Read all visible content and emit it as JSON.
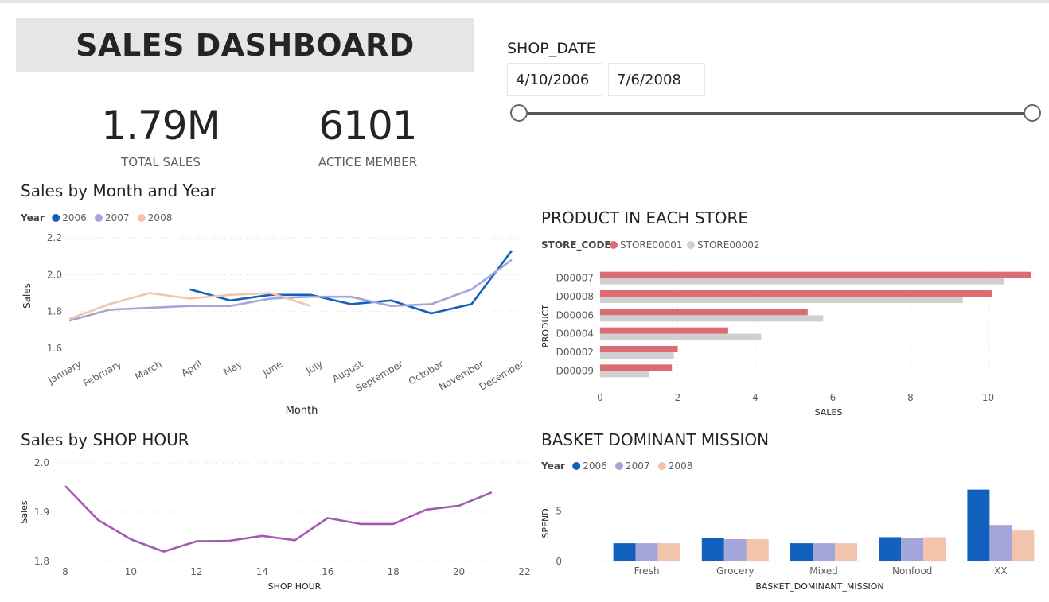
{
  "dashboard": {
    "title": "SALES DASHBOARD"
  },
  "kpis": [
    {
      "value": "1.79M",
      "label": "TOTAL SALES"
    },
    {
      "value": "6101",
      "label": "ACTICE MEMBER"
    }
  ],
  "slicer": {
    "title": "SHOP_DATE",
    "start": "4/10/2006",
    "end": "7/6/2008",
    "range_selected": [
      0.0,
      1.0
    ]
  },
  "colors": {
    "y2006": "#1261bf",
    "y2007": "#a4a5d8",
    "y2008": "#f2c4ac",
    "store1": "#dd6b73",
    "store2": "#cfcfcf",
    "hour_line": "#a35bb0"
  },
  "chart_data": [
    {
      "id": "month",
      "type": "line",
      "title": "Sales by Month and Year",
      "legend_title": "Year",
      "xlabel": "Month",
      "ylabel": "Sales",
      "categories": [
        "January",
        "February",
        "March",
        "April",
        "May",
        "June",
        "July",
        "August",
        "September",
        "October",
        "November",
        "December"
      ],
      "yticks": [
        "1.6",
        "1.8",
        "2.0",
        "2.2"
      ],
      "ylim": [
        1.57,
        2.2
      ],
      "series": [
        {
          "name": "2006",
          "color": "#1261bf",
          "values": [
            null,
            null,
            null,
            1.92,
            1.86,
            1.89,
            1.89,
            1.84,
            1.86,
            1.79,
            1.84,
            2.13
          ]
        },
        {
          "name": "2007",
          "color": "#a4a5d8",
          "values": [
            1.75,
            1.81,
            1.82,
            1.83,
            1.83,
            1.87,
            1.88,
            1.88,
            1.83,
            1.84,
            1.92,
            2.08
          ]
        },
        {
          "name": "2008",
          "color": "#f2c4ac",
          "values": [
            1.76,
            1.84,
            1.9,
            1.87,
            1.89,
            1.9,
            1.83,
            null,
            null,
            null,
            null,
            null
          ]
        }
      ]
    },
    {
      "id": "store",
      "type": "bar",
      "orientation": "horizontal",
      "title": "PRODUCT IN EACH STORE",
      "legend_title": "STORE_CODE",
      "xlabel": "SALES",
      "ylabel": "PRODUCT",
      "categories": [
        "D00007",
        "D00008",
        "D00006",
        "D00004",
        "D00002",
        "D00009"
      ],
      "xticks": [
        "0",
        "2",
        "4",
        "6",
        "8",
        "10"
      ],
      "xlim": [
        0,
        11.2
      ],
      "series": [
        {
          "name": "STORE00001",
          "color": "#dd6b73",
          "values": [
            11.1,
            10.1,
            5.35,
            3.3,
            2.0,
            1.85
          ]
        },
        {
          "name": "STORE00002",
          "color": "#cfcfcf",
          "values": [
            10.4,
            9.35,
            5.75,
            4.15,
            1.9,
            1.25
          ]
        }
      ]
    },
    {
      "id": "hour",
      "type": "line",
      "title": "Sales by SHOP HOUR",
      "xlabel": "SHOP HOUR",
      "ylabel": "Sales",
      "xticks": [
        "8",
        "10",
        "12",
        "14",
        "16",
        "18",
        "20",
        "22"
      ],
      "yticks": [
        "1.8",
        "1.9",
        "2.0"
      ],
      "xlim": [
        8,
        22
      ],
      "ylim": [
        1.8,
        2.0
      ],
      "series": [
        {
          "name": "",
          "color": "#a35bb0",
          "x": [
            8,
            9,
            10,
            11,
            12,
            13,
            14,
            15,
            16,
            17,
            18,
            19,
            20,
            21
          ],
          "values": [
            1.953,
            1.884,
            1.845,
            1.82,
            1.841,
            1.842,
            1.852,
            1.843,
            1.888,
            1.876,
            1.876,
            1.905,
            1.913,
            1.94
          ]
        }
      ]
    },
    {
      "id": "basket",
      "type": "bar",
      "orientation": "vertical",
      "title": "BASKET DOMINANT MISSION",
      "legend_title": "Year",
      "xlabel": "BASKET_DOMINANT_MISSION",
      "ylabel": "SPEND",
      "categories": [
        "Fresh",
        "Grocery",
        "Mixed",
        "Nonfood",
        "XX"
      ],
      "yticks": [
        "0",
        "5"
      ],
      "ylim": [
        0,
        7.7
      ],
      "series": [
        {
          "name": "2006",
          "color": "#1261bf",
          "values": [
            1.8,
            2.3,
            1.8,
            2.4,
            7.1
          ]
        },
        {
          "name": "2007",
          "color": "#a4a5d8",
          "values": [
            1.8,
            2.2,
            1.8,
            2.35,
            3.6
          ]
        },
        {
          "name": "2008",
          "color": "#f2c4ac",
          "values": [
            1.8,
            2.2,
            1.8,
            2.4,
            3.05
          ]
        }
      ]
    }
  ]
}
